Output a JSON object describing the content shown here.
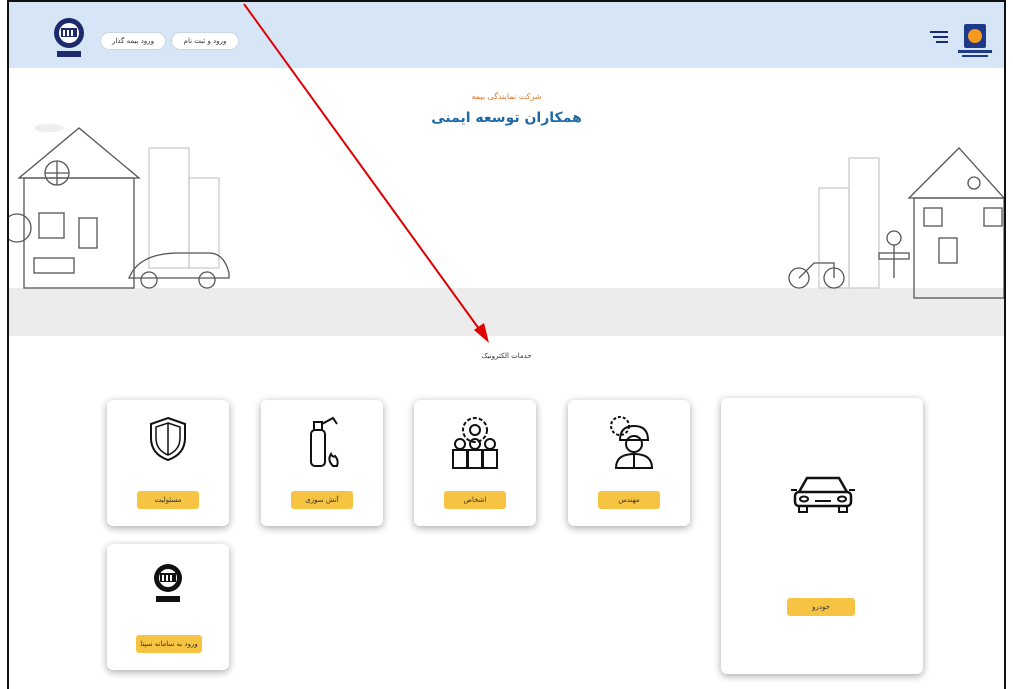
{
  "header": {
    "login_register": "ورود و ثبت نام",
    "insurer_login": "ورود بیمه گذار"
  },
  "hero": {
    "subtitle": "شرکت نمایندگی بیمه",
    "title": "همکاران توسعه ایمنی"
  },
  "services": {
    "title": "خدمات الکترونیک",
    "items": [
      {
        "label": "مسئولیت",
        "icon": "shield-icon"
      },
      {
        "label": "آتش سوزی",
        "icon": "fire-extinguisher-icon"
      },
      {
        "label": "اشخاص",
        "icon": "people-icon"
      },
      {
        "label": "مهندس",
        "icon": "engineer-icon"
      },
      {
        "label": "خودرو",
        "icon": "car-icon"
      },
      {
        "label": "ورود به سامانه سپتا",
        "icon": "bimeh-asia-logo"
      }
    ]
  },
  "colors": {
    "header_bg": "#d6e6f7",
    "button_yellow": "#f6c343",
    "title_blue": "#1f6aa5",
    "subtitle_orange": "#e07a2c",
    "annotation_red": "#e00000"
  }
}
